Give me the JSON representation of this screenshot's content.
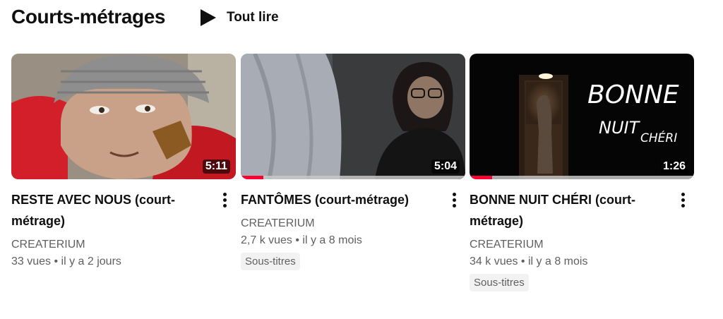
{
  "section": {
    "title": "Courts-métrages",
    "play_all_label": "Tout lire"
  },
  "colors": {
    "progress": "#ff0033",
    "text_primary": "#0f0f0f",
    "text_secondary": "#606060"
  },
  "icons": {
    "play_all": "play-triangle-icon",
    "menu": "more-vert-icon"
  },
  "videos": [
    {
      "title": "RESTE AVEC NOUS (court-métrage)",
      "duration": "5:11",
      "channel": "CREATERIUM",
      "meta": "33 vues • il y a 2 jours",
      "badge": "",
      "watched_fraction": 0
    },
    {
      "title": "FANTÔMES (court-métrage)",
      "duration": "5:04",
      "channel": "CREATERIUM",
      "meta": "2,7 k vues • il y a 8 mois",
      "badge": "Sous-titres",
      "watched_fraction": 0.1
    },
    {
      "title": "BONNE NUIT CHÉRI (court-métrage)",
      "duration": "1:26",
      "channel": "CREATERIUM",
      "meta": "34 k vues • il y a 8 mois",
      "badge": "Sous-titres",
      "watched_fraction": 0.1,
      "thumbnail_text": [
        "BONNE",
        "NUIT",
        "CHÉRI"
      ]
    }
  ]
}
